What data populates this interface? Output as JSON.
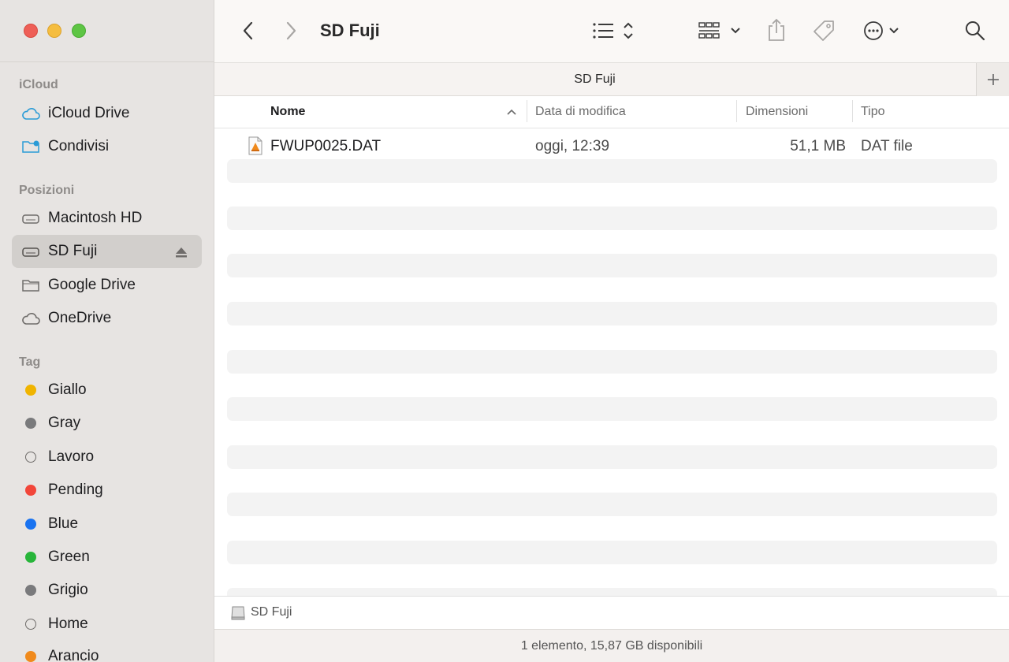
{
  "window": {
    "title": "SD Fuji"
  },
  "sidebar": {
    "sections": {
      "icloud": "iCloud",
      "locations": "Posizioni",
      "tags": "Tag"
    },
    "icloud_items": [
      {
        "label": "iCloud Drive",
        "icon": "cloud-icon"
      },
      {
        "label": "Condivisi",
        "icon": "shared-folder-icon"
      }
    ],
    "location_items": [
      {
        "label": "Macintosh HD",
        "icon": "drive-icon"
      },
      {
        "label": "SD Fuji",
        "icon": "drive-icon",
        "selected": true,
        "eject": true
      },
      {
        "label": "Google Drive",
        "icon": "folder-icon"
      },
      {
        "label": "OneDrive",
        "icon": "cloud-icon"
      }
    ],
    "tag_items": [
      {
        "label": "Giallo",
        "color": "#f0b400"
      },
      {
        "label": "Gray",
        "color": "#7a7a7c"
      },
      {
        "label": "Lavoro",
        "color": ""
      },
      {
        "label": "Pending",
        "color": "#f2463a"
      },
      {
        "label": "Blue",
        "color": "#1a73f0"
      },
      {
        "label": "Green",
        "color": "#28b53a"
      },
      {
        "label": "Grigio",
        "color": "#7a7a7c"
      },
      {
        "label": "Home",
        "color": ""
      },
      {
        "label": "Arancio",
        "color": "#f08a1c"
      }
    ]
  },
  "tab": {
    "title": "SD Fuji"
  },
  "columns": {
    "name": "Nome",
    "modified": "Data di modifica",
    "size": "Dimensioni",
    "kind": "Tipo"
  },
  "files": [
    {
      "name": "FWUP0025.DAT",
      "modified": "oggi, 12:39",
      "size": "51,1 MB",
      "kind": "DAT file"
    }
  ],
  "pathbar": {
    "label": "SD Fuji"
  },
  "status": {
    "text": "1 elemento, 15,87 GB disponibili"
  },
  "colors": {
    "accent": "#1a73f0",
    "sidebar_bg": "#e7e4e2",
    "selected_bg": "#d2cfcc"
  }
}
